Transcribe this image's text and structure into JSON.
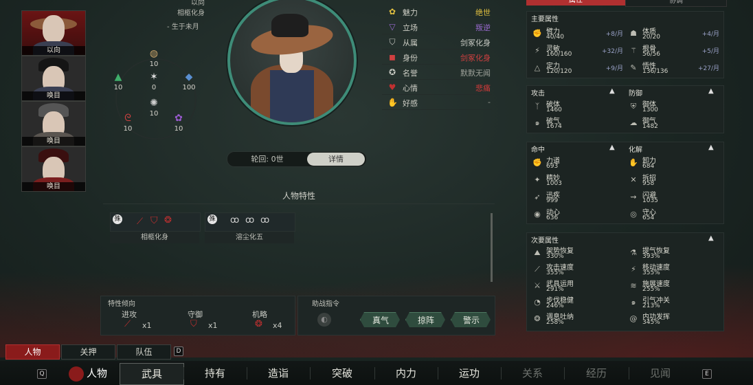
{
  "character": {
    "name_top": "以向",
    "title": "相柩化身",
    "birth": "- 生于未月"
  },
  "portraits": [
    {
      "name": "以向"
    },
    {
      "name": "唤目"
    },
    {
      "name": "唤目"
    },
    {
      "name": "唤目"
    }
  ],
  "wheel": {
    "top": "10",
    "left": "10",
    "center_top": "0",
    "right": "100",
    "center_bottom": "10",
    "bottom_left": "10",
    "bottom_right": "10"
  },
  "info": [
    {
      "key": "魅力",
      "value": "绝世",
      "color": "#e2c040",
      "icon": "flower-icon"
    },
    {
      "key": "立场",
      "value": "叛逆",
      "color": "#9a6ad0",
      "icon": "triangle-icon"
    },
    {
      "key": "从属",
      "value": "剑冢化身",
      "color": "#c9cbc4",
      "icon": "shield-icon"
    },
    {
      "key": "身份",
      "value": "剑冢化身",
      "color": "#d04040",
      "icon": "seal-icon"
    },
    {
      "key": "名誉",
      "value": "默默无闻",
      "color": "#9ea19a",
      "icon": "medal-icon"
    },
    {
      "key": "心情",
      "value": "悲痛",
      "color": "#d03a3a",
      "icon": "heart-icon"
    },
    {
      "key": "好感",
      "value": "-",
      "color": "#9ea19a",
      "icon": "hand-icon"
    }
  ],
  "toggle": {
    "left": "轮回: 0世",
    "right": "详情"
  },
  "traits": {
    "title": "人物特性",
    "items": [
      {
        "badge": "殊",
        "label": "相柩化身"
      },
      {
        "badge": "殊",
        "label": "溶尘化五"
      }
    ]
  },
  "tendency": {
    "title": "特性倾向",
    "items": [
      {
        "label": "进攻",
        "count": "x1"
      },
      {
        "label": "守御",
        "count": "x1"
      },
      {
        "label": "机略",
        "count": "x4"
      }
    ]
  },
  "assist": {
    "title": "助战指令",
    "buttons": [
      "真气",
      "掠阵",
      "警示"
    ]
  },
  "right_tabs": {
    "active": "属性",
    "other": "协调"
  },
  "main_attrs": {
    "title": "主要属性",
    "items": [
      {
        "key": "臂力",
        "value": "40/40",
        "delta": "+8/月"
      },
      {
        "key": "体质",
        "value": "20/20",
        "delta": "+4/月"
      },
      {
        "key": "灵敏",
        "value": "160/160",
        "delta": "+32/月"
      },
      {
        "key": "根骨",
        "value": "56/56",
        "delta": "+5/月"
      },
      {
        "key": "定力",
        "value": "120/120",
        "delta": "+9/月"
      },
      {
        "key": "悟性",
        "value": "136/136",
        "delta": "+27/月"
      }
    ]
  },
  "attack_defense": {
    "attack_title": "攻击",
    "defense_title": "防御",
    "attack": [
      {
        "key": "破体",
        "value": "1460"
      },
      {
        "key": "破气",
        "value": "1674"
      }
    ],
    "defense": [
      {
        "key": "御体",
        "value": "1300"
      },
      {
        "key": "御气",
        "value": "1482"
      }
    ]
  },
  "hit_dodge": {
    "hit_title": "命中",
    "dodge_title": "化解",
    "hit": [
      {
        "key": "力道",
        "value": "693"
      },
      {
        "key": "精妙",
        "value": "1003"
      },
      {
        "key": "迅疾",
        "value": "999"
      },
      {
        "key": "动心",
        "value": "636"
      }
    ],
    "dodge": [
      {
        "key": "卸力",
        "value": "684"
      },
      {
        "key": "拆招",
        "value": "958"
      },
      {
        "key": "闪避",
        "value": "1035"
      },
      {
        "key": "守心",
        "value": "654"
      }
    ]
  },
  "secondary": {
    "title": "次要属性",
    "items": [
      {
        "key": "架势恢复",
        "value": "330%"
      },
      {
        "key": "提气恢复",
        "value": "393%"
      },
      {
        "key": "攻击速度",
        "value": "355%"
      },
      {
        "key": "移动速度",
        "value": "355%"
      },
      {
        "key": "武具运用",
        "value": "291%"
      },
      {
        "key": "施展速度",
        "value": "255%"
      },
      {
        "key": "步伐稳健",
        "value": "246%"
      },
      {
        "key": "引气冲关",
        "value": "213%"
      },
      {
        "key": "调息吐纳",
        "value": "258%"
      },
      {
        "key": "内功发挥",
        "value": "345%"
      }
    ]
  },
  "subtabs": {
    "items": [
      "人物",
      "关押",
      "队伍"
    ],
    "key": "D"
  },
  "nav": {
    "key_left": "Q",
    "key_right": "E",
    "items": [
      "人物",
      "武具",
      "持有",
      "造诣",
      "突破",
      "内力",
      "运功",
      "关系",
      "经历",
      "见闻"
    ]
  },
  "colors": {
    "accent_green": "#3e8c78",
    "accent_red": "#8a1b1b"
  }
}
